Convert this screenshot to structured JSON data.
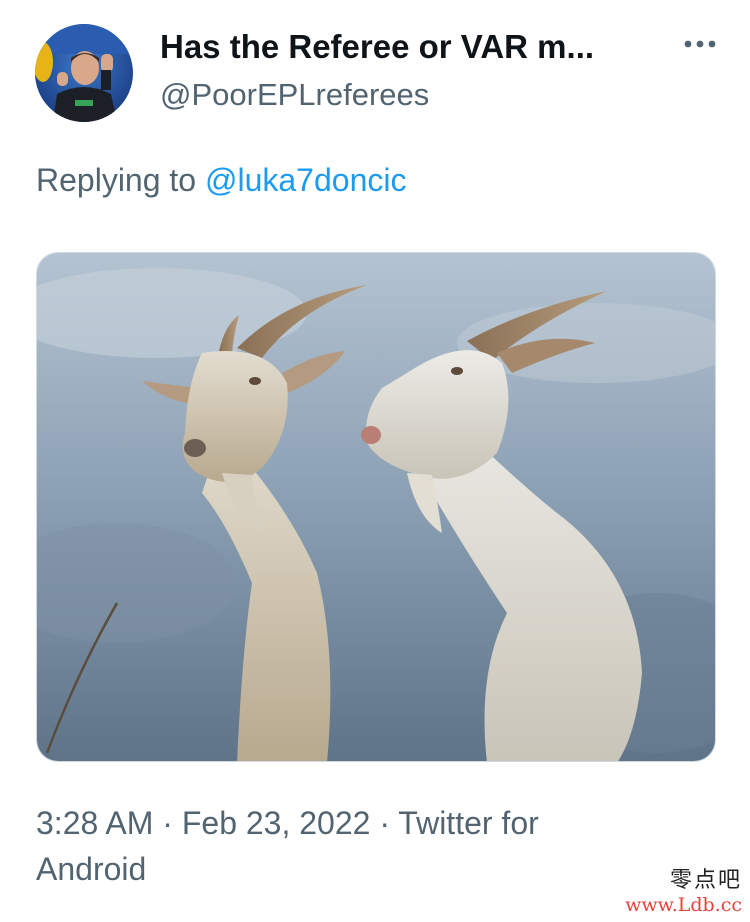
{
  "tweet": {
    "display_name": "Has the Referee or VAR m...",
    "handle": "@PoorEPLreferees",
    "more_icon": "more-horizontal-icon",
    "replying_prefix": "Replying to",
    "replying_to": "@luka7doncic",
    "time": "3:28 AM",
    "separator": "·",
    "date": "Feb 23, 2022",
    "source": "Twitter for Android"
  },
  "watermark": {
    "chinese": "零点吧",
    "url": "www.Ldb.cc"
  },
  "colors": {
    "text_primary": "#0f1419",
    "text_secondary": "#536471",
    "link": "#1d9bf0"
  }
}
